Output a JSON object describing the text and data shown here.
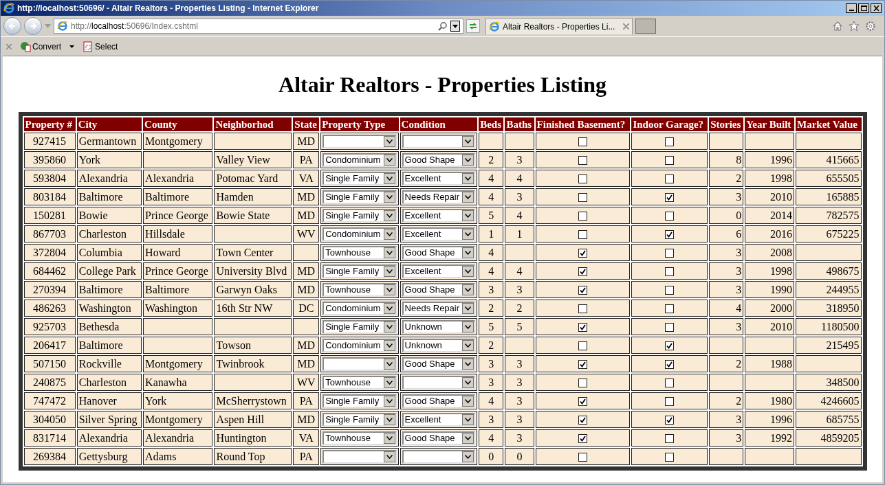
{
  "window": {
    "title": "http://localhost:50696/ - Altair Realtors - Properties Listing - Internet Explorer"
  },
  "address_bar": {
    "url_prefix": "http://",
    "url_host": "localhost",
    "url_rest": ":50696/Index.cshtml"
  },
  "tabs": [
    {
      "label": "Altair Realtors - Properties Li...",
      "selected": true
    }
  ],
  "command_bar": [
    {
      "label": "Convert",
      "kind": "menu"
    },
    {
      "label": "Select",
      "kind": "plain"
    }
  ],
  "page": {
    "heading": "Altair Realtors - Properties Listing"
  },
  "table": {
    "columns": [
      {
        "label": "Property #",
        "kind": "center"
      },
      {
        "label": "City",
        "kind": "text"
      },
      {
        "label": "County",
        "kind": "text"
      },
      {
        "label": "Neighborhod",
        "kind": "text"
      },
      {
        "label": "State",
        "kind": "center"
      },
      {
        "label": "Property Type",
        "kind": "select"
      },
      {
        "label": "Condition",
        "kind": "select"
      },
      {
        "label": "Beds",
        "kind": "center"
      },
      {
        "label": "Baths",
        "kind": "center"
      },
      {
        "label": "Finished Basement?",
        "kind": "check"
      },
      {
        "label": "Indoor Garage?",
        "kind": "check"
      },
      {
        "label": "Stories",
        "kind": "number"
      },
      {
        "label": "Year Built",
        "kind": "number"
      },
      {
        "label": "Market Value",
        "kind": "number"
      }
    ],
    "rows": [
      [
        "927415",
        "Germantown",
        "Montgomery",
        null,
        "MD",
        null,
        null,
        null,
        null,
        false,
        false,
        null,
        null,
        null
      ],
      [
        "395860",
        "York",
        null,
        "Valley View",
        "PA",
        "Condominium",
        "Good Shape",
        "2",
        "3",
        false,
        false,
        "8",
        "1996",
        "415665"
      ],
      [
        "593804",
        "Alexandria",
        "Alexandria",
        "Potomac Yard",
        "VA",
        "Single Family",
        "Excellent",
        "4",
        "4",
        false,
        false,
        "2",
        "1998",
        "655505"
      ],
      [
        "803184",
        "Baltimore",
        "Baltimore",
        "Hamden",
        "MD",
        "Single Family",
        "Needs Repair",
        "4",
        "3",
        false,
        true,
        "3",
        "2010",
        "165885"
      ],
      [
        "150281",
        "Bowie",
        "Prince George",
        "Bowie State",
        "MD",
        "Single Family",
        "Excellent",
        "5",
        "4",
        false,
        false,
        "0",
        "2014",
        "782575"
      ],
      [
        "867703",
        "Charleston",
        "Hillsdale",
        null,
        "WV",
        "Condominium",
        "Excellent",
        "1",
        "1",
        false,
        true,
        "6",
        "2016",
        "675225"
      ],
      [
        "372804",
        "Columbia",
        "Howard",
        "Town Center",
        null,
        "Townhouse",
        "Good Shape",
        "4",
        null,
        true,
        false,
        "3",
        "2008",
        null
      ],
      [
        "684462",
        "College Park",
        "Prince George",
        "University Blvd",
        "MD",
        "Single Family",
        "Excellent",
        "4",
        "4",
        true,
        false,
        "3",
        "1998",
        "498675"
      ],
      [
        "270394",
        "Baltimore",
        "Baltimore",
        "Garwyn Oaks",
        "MD",
        "Townhouse",
        "Good Shape",
        "3",
        "3",
        true,
        false,
        "3",
        "1990",
        "244955"
      ],
      [
        "486263",
        "Washington",
        "Washington",
        "16th Str NW",
        "DC",
        "Condominium",
        "Needs Repair",
        "2",
        "2",
        false,
        false,
        "4",
        "2000",
        "318950"
      ],
      [
        "925703",
        "Bethesda",
        null,
        null,
        null,
        "Single Family",
        "Unknown",
        "5",
        "5",
        true,
        false,
        "3",
        "2010",
        "1180500"
      ],
      [
        "206417",
        "Baltimore",
        null,
        "Towson",
        "MD",
        "Condominium",
        "Unknown",
        "2",
        null,
        false,
        true,
        null,
        null,
        "215495"
      ],
      [
        "507150",
        "Rockville",
        "Montgomery",
        "Twinbrook",
        "MD",
        null,
        "Good Shape",
        "3",
        "3",
        true,
        true,
        "2",
        "1988",
        null
      ],
      [
        "240875",
        "Charleston",
        "Kanawha",
        null,
        "WV",
        "Townhouse",
        null,
        "3",
        "3",
        false,
        false,
        null,
        null,
        "348500"
      ],
      [
        "747472",
        "Hanover",
        "York",
        "McSherrystown",
        "PA",
        "Single Family",
        "Good Shape",
        "4",
        "3",
        true,
        false,
        "2",
        "1980",
        "4246605"
      ],
      [
        "304050",
        "Silver Spring",
        "Montgomery",
        "Aspen Hill",
        "MD",
        "Single Family",
        "Excellent",
        "3",
        "3",
        true,
        true,
        "3",
        "1996",
        "685755"
      ],
      [
        "831714",
        "Alexandria",
        "Alexandria",
        "Huntington",
        "VA",
        "Townhouse",
        "Good Shape",
        "4",
        "3",
        true,
        false,
        "3",
        "1992",
        "4859205"
      ],
      [
        "269384",
        "Gettysburg",
        "Adams",
        "Round Top",
        "PA",
        null,
        null,
        "0",
        "0",
        false,
        false,
        null,
        null,
        null
      ]
    ]
  }
}
